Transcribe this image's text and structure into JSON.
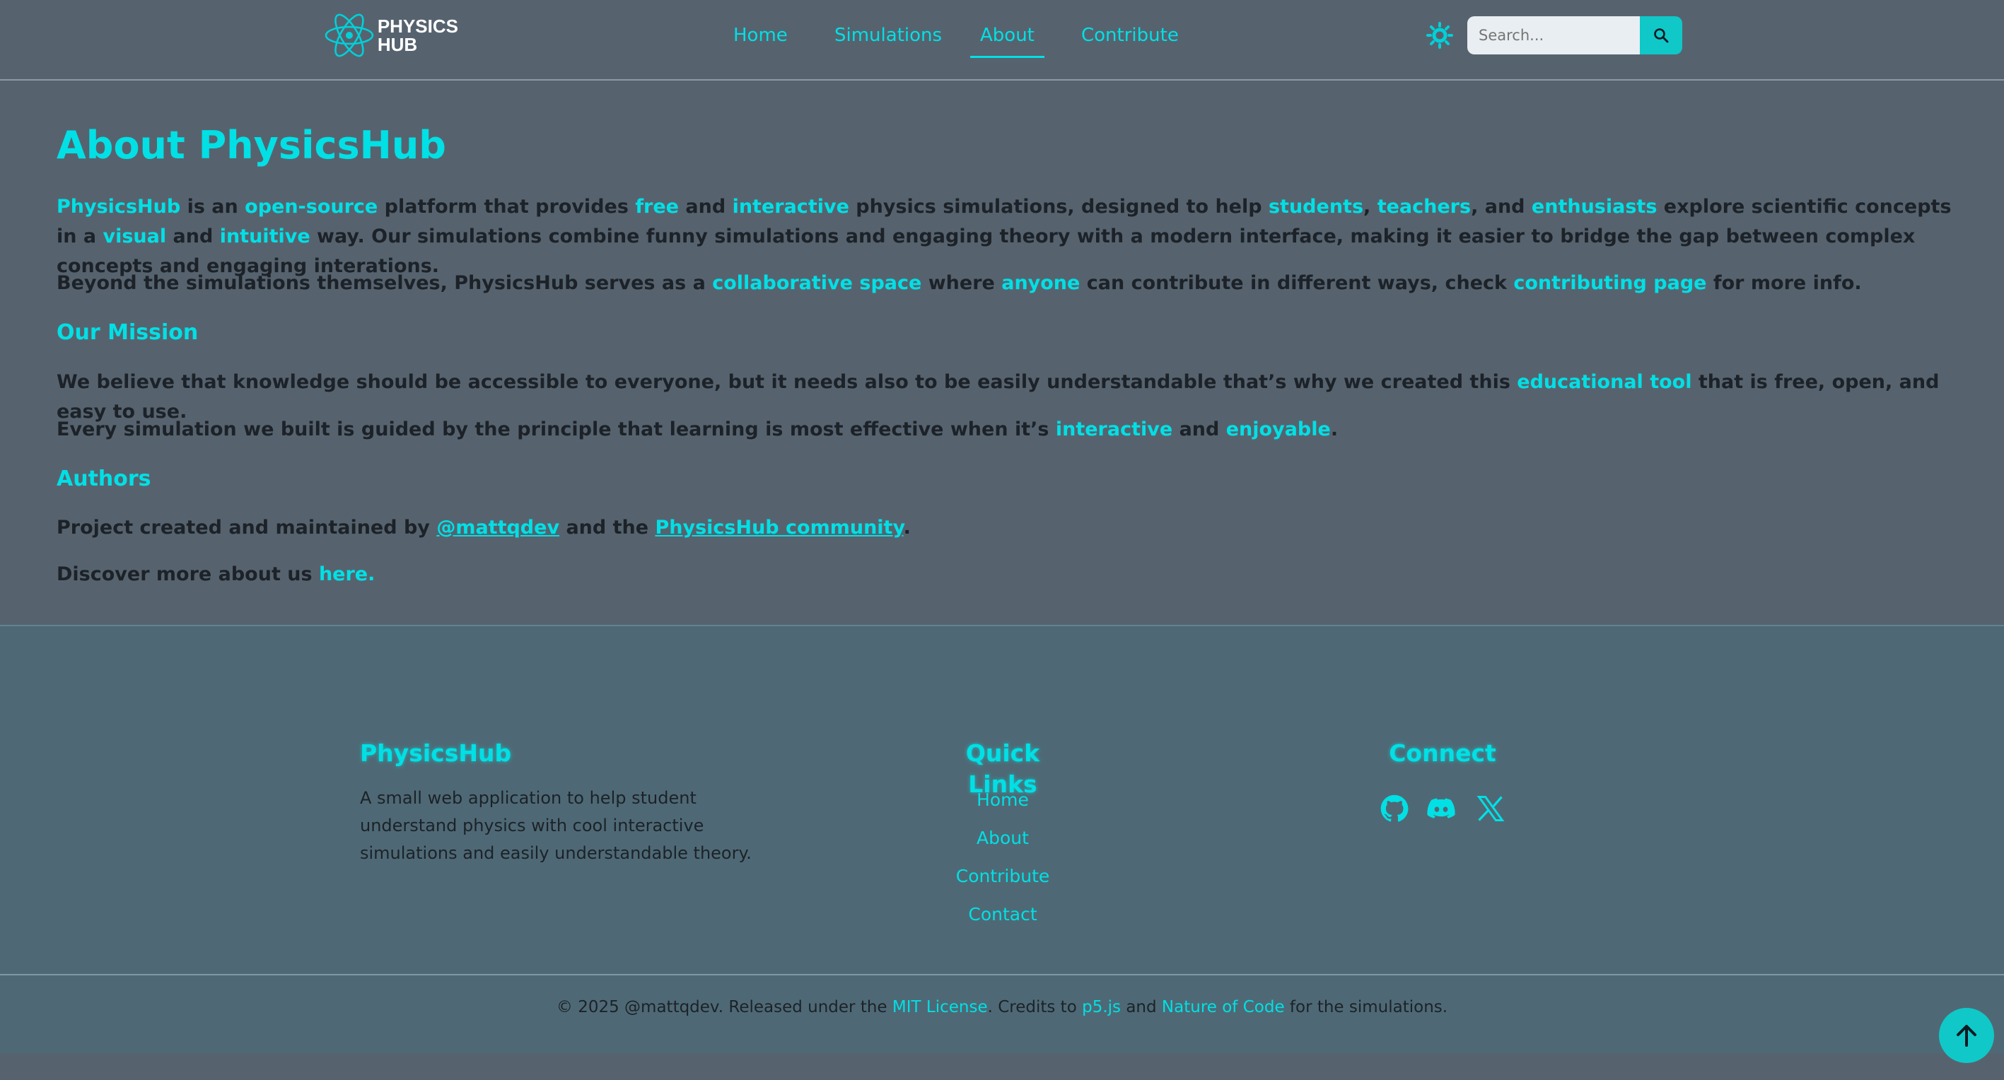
{
  "brand": {
    "line1": "PHYSICS",
    "line2": "HUB"
  },
  "nav": {
    "home": "Home",
    "simulations": "Simulations",
    "about": "About",
    "contribute": "Contribute",
    "active": "About"
  },
  "search": {
    "placeholder": "Search..."
  },
  "colors": {
    "accent": "#00e0e5",
    "background": "#56636f",
    "footer": "#4e6975",
    "text": "#1c2228"
  },
  "icons": {
    "theme": "sun-icon",
    "search": "search-icon",
    "scroll": "arrow-up-icon"
  },
  "about": {
    "title": "About PhysicsHub",
    "p1": {
      "t1": "PhysicsHub",
      "t2": " is an ",
      "t3": "open-source",
      "t4": " platform that provides ",
      "t5": "free",
      "t6": " and ",
      "t7": "interactive",
      "t8": " physics simulations, designed to help ",
      "t9": "students",
      "t10": ", ",
      "t11": "teachers",
      "t12": ", and ",
      "t13": "enthusiasts",
      "t14": " explore scientific concepts in a ",
      "t15": "visual",
      "t16": " and ",
      "t17": "intuitive",
      "t18": " way. Our simulations combine funny simulations and engaging theory with a modern interface, making it easier to bridge the gap between complex concepts and engaging interations."
    },
    "p2": {
      "t1": "Beyond the simulations themselves, PhysicsHub serves as a ",
      "t2": "collaborative space",
      "t3": " where ",
      "t4": "anyone",
      "t5": " can contribute in different ways, check ",
      "t6": "contributing page",
      "t7": " for more info."
    },
    "mission_title": "Our Mission",
    "p3": {
      "t1": "We believe that knowledge should be accessible to everyone, but it needs also to be easily understandable that’s why we created this ",
      "t2": "educational tool",
      "t3": " that is free, open, and easy to use."
    },
    "p4": {
      "t1": "Every simulation we built is guided by the principle that learning is most effective when it’s ",
      "t2": "interactive",
      "t3": " and ",
      "t4": "enjoyable",
      "t5": "."
    },
    "authors_title": "Authors",
    "p5": {
      "t1": "Project created and maintained by ",
      "t2": "@mattqdev",
      "t3": " and the ",
      "t4": "PhysicsHub community",
      "t5": "."
    },
    "p6": {
      "t1": "Discover more about us ",
      "t2": "here."
    }
  },
  "footer": {
    "brand_title": "PhysicsHub",
    "description": "A small web application to help student understand physics with cool interactive simulations and easily understandable theory.",
    "quick_title": "Quick Links",
    "quick_links": [
      "Home",
      "About",
      "Contribute",
      "Contact"
    ],
    "connect_title": "Connect",
    "social": [
      "github-icon",
      "discord-icon",
      "x-icon"
    ],
    "copyright": {
      "t1": "© 2025 @mattqdev. Released under the ",
      "t2": "MIT License",
      "t3": ". Credits to ",
      "t4": "p5.js",
      "t5": " and ",
      "t6": "Nature of Code",
      "t7": " for the simulations."
    }
  }
}
